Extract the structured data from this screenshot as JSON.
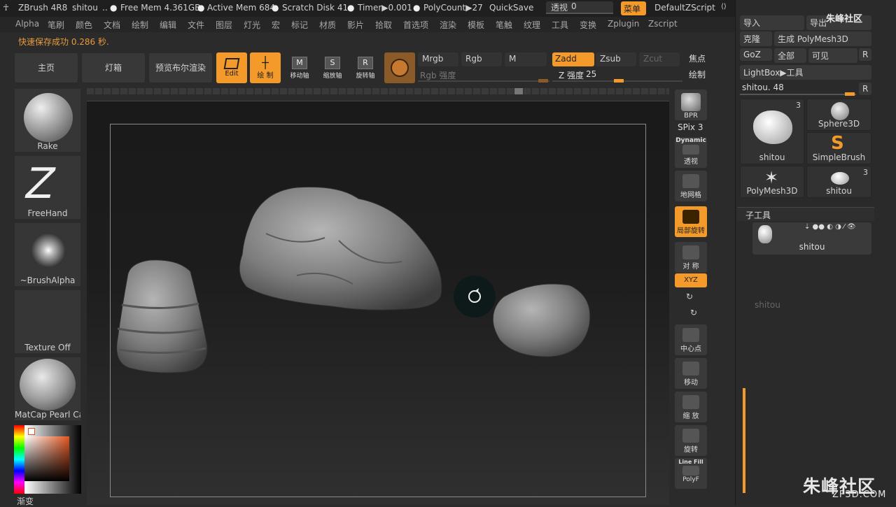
{
  "titlebar": {
    "app": "ZBrush 4R8",
    "project": "shitou",
    "ellipsis": "..",
    "free_mem": "Free Mem 4.361GB",
    "active_mem": "Active Mem 684",
    "scratch": "Scratch Disk 41",
    "timer": "Timer▶0.001",
    "polycount": "PolyCount▶27",
    "quicksave": "QuickSave",
    "transparency": "透视",
    "transparency_value": "0",
    "menu": "菜单",
    "zscript": "DefaultZScript"
  },
  "menubar": [
    "Alpha",
    "笔刷",
    "颜色",
    "文档",
    "绘制",
    "编辑",
    "文件",
    "图层",
    "灯光",
    "宏",
    "标记",
    "材质",
    "影片",
    "拾取",
    "首选项",
    "渲染",
    "模板",
    "笔触",
    "纹理",
    "工具",
    "变换",
    "Zplugin",
    "Zscript"
  ],
  "status": "快速保存成功 0.286 秒.",
  "toolbar": {
    "home": "主页",
    "lightbox": "灯箱",
    "bpr_preview": "预览布尔渲染",
    "edit": "Edit",
    "draw": "绘 制",
    "move": "移动轴",
    "scale": "缩放轴",
    "rotate": "旋转轴",
    "move_glyph": "M",
    "scale_glyph": "S",
    "rotate_glyph": "R",
    "mrgb": "Mrgb",
    "rgb": "Rgb",
    "m": "M",
    "rgb_intensity": "Rgb 强度",
    "zadd": "Zadd",
    "zsub": "Zsub",
    "zcut": "Zcut",
    "z_intensity": "Z 强度",
    "z_intensity_value": "25",
    "focal": "焦点",
    "draw_size": "绘制"
  },
  "leftshelf": {
    "brush": "Rake",
    "stroke": "FreeHand",
    "alpha": "~BrushAlpha",
    "texture": "Texture Off",
    "material": "MatCap Pearl Ca",
    "gradient": "渐变"
  },
  "righttools": {
    "bpr": "BPR",
    "spix": "SPix 3",
    "dynamic": "Dynamic",
    "persp": "透视",
    "floor": "地网格",
    "local": "局部旋转",
    "sym": "对 称",
    "xyz": "XYZ",
    "center": "中心点",
    "move": "移动",
    "zoom": "缩 放",
    "rotate": "旋转",
    "linefill": "Line Fill",
    "polyf": "PolyF"
  },
  "rightpanel": {
    "import": "导入",
    "export": "导出",
    "clone": "克隆",
    "make_polymesh": "生成 PolyMesh3D",
    "goz": "GoZ",
    "all": "全部",
    "visible": "可见",
    "r": "R",
    "lightbox_tool": "LightBox▶工具",
    "current_tool": "shitou. 48",
    "tools": [
      {
        "name": "shitou",
        "count": "3"
      },
      {
        "name": "Sphere3D",
        "count": ""
      },
      {
        "name": "SimpleBrush",
        "count": ""
      },
      {
        "name": "PolyMesh3D",
        "count": ""
      },
      {
        "name": "shitou",
        "count": "3"
      }
    ],
    "subtool_title": "子工具",
    "subtool_name": "shitou",
    "subtool_ghost": "shitou"
  },
  "watermark": {
    "cn": "朱峰社区",
    "domain": "ZF3D.COM"
  },
  "colors": {
    "accent": "#f39a2a",
    "status": "#e89b3c",
    "panel": "#2a2a2a"
  }
}
